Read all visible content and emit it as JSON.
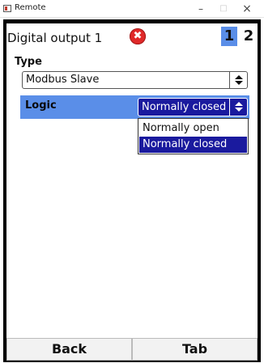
{
  "window": {
    "title": "Remote",
    "minimize": "–",
    "maximize": "□",
    "close": "×"
  },
  "header": {
    "title": "Digital output 1",
    "error_symbol": "✖",
    "tabs": [
      "1",
      "2"
    ],
    "active_tab": "1"
  },
  "type_field": {
    "label": "Type",
    "value": "Modbus Slave"
  },
  "logic_field": {
    "label": "Logic",
    "value": "Normally closed",
    "options": [
      "Normally open",
      "Normally closed"
    ],
    "selected_option": "Normally closed"
  },
  "footer": {
    "back_label": "Back",
    "tab_label": "Tab"
  },
  "colors": {
    "highlight": "#5a8ee8",
    "selection": "#1a1a9e",
    "error": "#e02929"
  }
}
